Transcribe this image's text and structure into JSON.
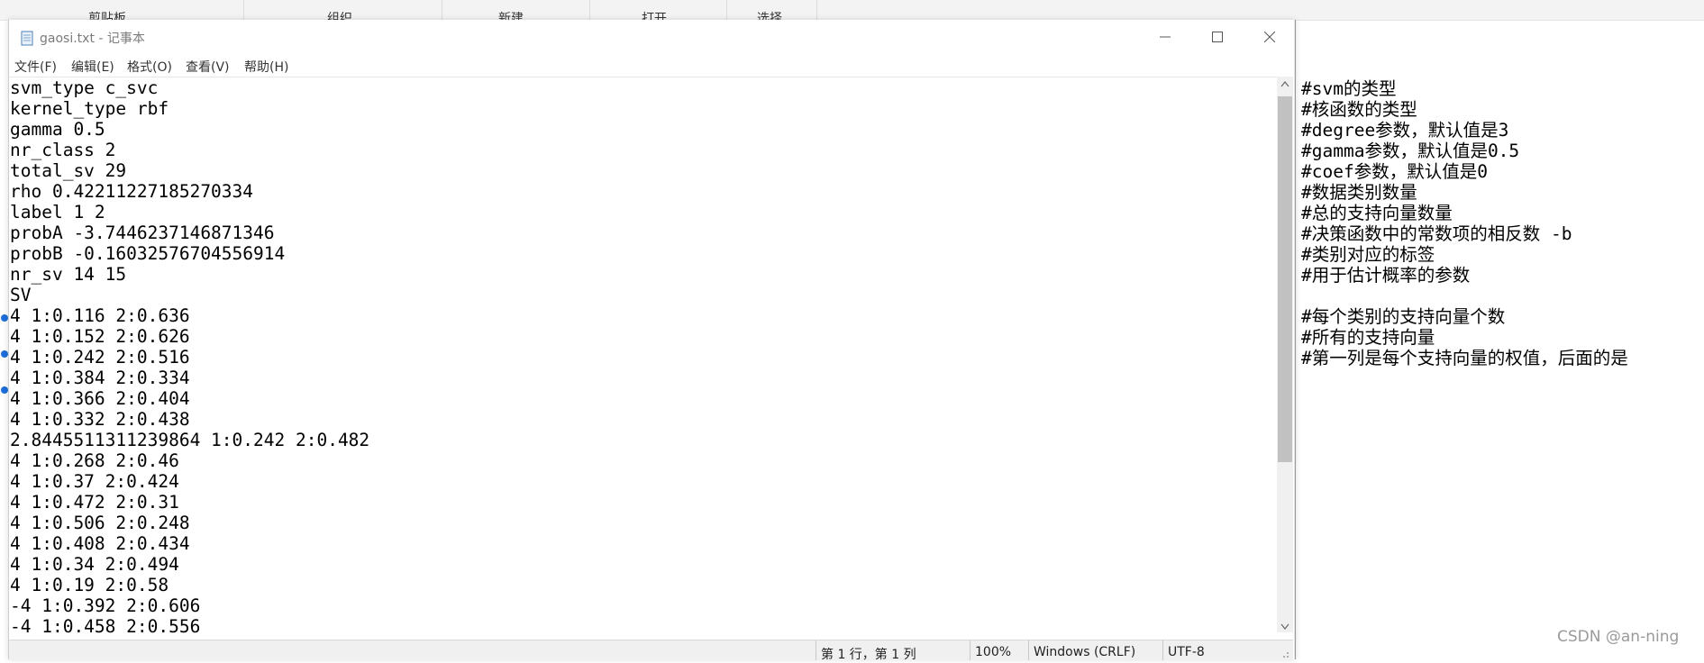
{
  "background_ribbon": [
    "剪贴板",
    "组织",
    "新建",
    "打开",
    "选择"
  ],
  "window": {
    "title": "gaosi.txt - 记事本",
    "icon": "notepad-icon"
  },
  "menu": [
    "文件(F)",
    "编辑(E)",
    "格式(O)",
    "查看(V)",
    "帮助(H)"
  ],
  "editor_lines": [
    "svm_type c_svc",
    "kernel_type rbf",
    "gamma 0.5",
    "nr_class 2",
    "total_sv 29",
    "rho 0.42211227185270334",
    "label 1 2",
    "probA -3.7446237146871346",
    "probB -0.16032576704556914",
    "nr_sv 14 15",
    "SV",
    "4 1:0.116 2:0.636",
    "4 1:0.152 2:0.626",
    "4 1:0.242 2:0.516",
    "4 1:0.384 2:0.334",
    "4 1:0.366 2:0.404",
    "4 1:0.332 2:0.438",
    "2.8445511311239864 1:0.242 2:0.482",
    "4 1:0.268 2:0.46",
    "4 1:0.37 2:0.424",
    "4 1:0.472 2:0.31",
    "4 1:0.506 2:0.248",
    "4 1:0.408 2:0.434",
    "4 1:0.34 2:0.494",
    "4 1:0.19 2:0.58",
    "-4 1:0.392 2:0.606",
    "-4 1:0.458 2:0.556"
  ],
  "status": {
    "position": "第 1 行，第 1 列",
    "zoom": "100%",
    "line_ending": "Windows (CRLF)",
    "encoding": "UTF-8"
  },
  "comments": [
    "#svm的类型",
    "#核函数的类型",
    "#degree参数，默认值是3",
    "#gamma参数，默认值是0.5",
    "#coef参数，默认值是0",
    "#数据类别数量",
    "#总的支持向量数量",
    "#决策函数中的常数项的相反数 -b",
    "#类别对应的标签",
    "#用于估计概率的参数",
    "",
    "#每个类别的支持向量个数",
    "#所有的支持向量",
    "#第一列是每个支持向量的权值，后面的是"
  ],
  "watermark": "CSDN @an-ning",
  "colors": {
    "selection_handle": "#1e6fd9",
    "scroll_thumb": "#c1c1c1"
  }
}
